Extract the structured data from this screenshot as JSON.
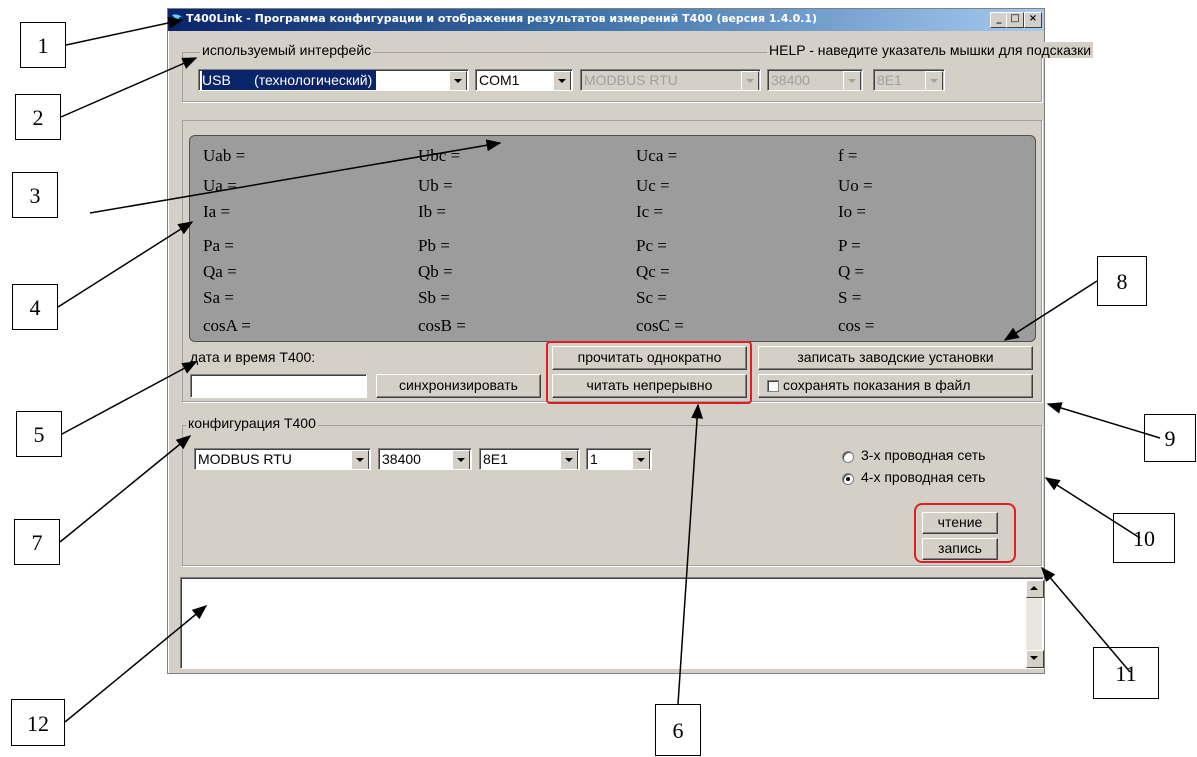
{
  "window": {
    "title": "T400Link - Программа конфигурации и отображения результатов измерений T400 (версия 1.4.0.1)",
    "controls": {
      "minimize": "_",
      "maximize": "□",
      "close": "×"
    }
  },
  "interface": {
    "legend": "используемый интерфейс",
    "help": "HELP - наведите указатель мышки для подсказки",
    "type": "USB      (технологический)",
    "port": "COM1",
    "protocol": "MODBUS RTU",
    "baud": "38400",
    "format": "8E1"
  },
  "measurements": [
    [
      "Uab =",
      "Ubc =",
      "Uca =",
      "f ="
    ],
    [
      "Ua =",
      "Ub =",
      "Uc =",
      "Uo ="
    ],
    [
      "Ia =",
      "Ib =",
      "Ic =",
      "Io ="
    ],
    [
      "Pa =",
      "Pb =",
      "Pc =",
      "P ="
    ],
    [
      "Qa =",
      "Qb =",
      "Qc =",
      "Q ="
    ],
    [
      "Sa =",
      "Sb =",
      "Sc =",
      "S ="
    ],
    [
      "cosA =",
      "cosB =",
      "cosC =",
      "cos ="
    ]
  ],
  "datetime": {
    "label": "дата и время T400:",
    "value": "",
    "sync_button": "синхронизировать"
  },
  "actions": {
    "read_once": "прочитать однократно",
    "read_continuous": "читать непрерывно",
    "write_factory": "записать заводские установки",
    "save_to_file": "сохранять показания в файл",
    "save_to_file_checked": false
  },
  "config": {
    "legend": "конфигурация T400",
    "protocol": "MODBUS RTU",
    "baud": "38400",
    "format": "8E1",
    "address": "1",
    "net3": "3-х проводная сеть",
    "net4": "4-х проводная сеть",
    "selected_net": "4",
    "read_button": "чтение",
    "write_button": "запись"
  },
  "log": {
    "text": ""
  },
  "callouts": [
    "1",
    "2",
    "3",
    "4",
    "5",
    "6",
    "7",
    "8",
    "9",
    "10",
    "11",
    "12"
  ]
}
